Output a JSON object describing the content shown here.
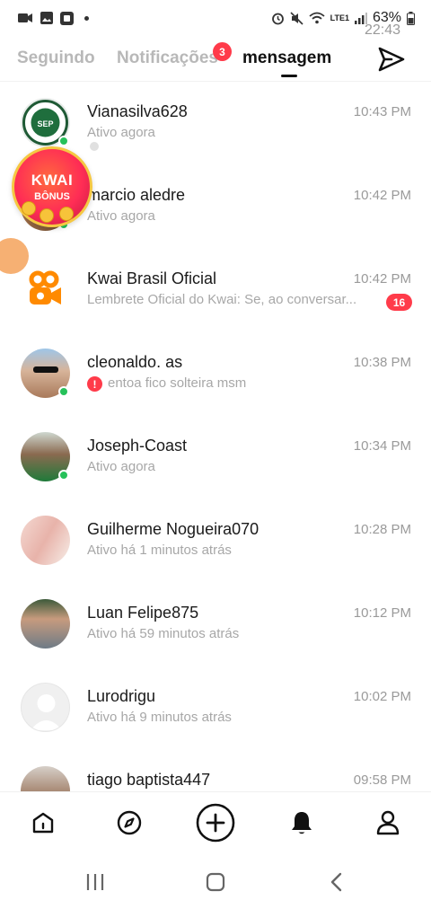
{
  "status_bar": {
    "time": "22:43",
    "battery": "63%",
    "network": "LTE1"
  },
  "tabs": [
    {
      "label": "Seguindo",
      "active": false
    },
    {
      "label": "Notificações",
      "active": false,
      "badge": "3"
    },
    {
      "label": "mensagem",
      "active": true
    }
  ],
  "conversations": [
    {
      "name": "Vianasilva628",
      "time": "10:43 PM",
      "subtitle": "Ativo agora",
      "online": true,
      "avatar": "palmeiras-logo"
    },
    {
      "name": "marcio aledre",
      "time": "10:42 PM",
      "subtitle": "Ativo agora",
      "online": true,
      "avatar": "photo"
    },
    {
      "name": "Kwai Brasil Oficial",
      "time": "10:42 PM",
      "subtitle": "Lembrete Oficial do Kwai: Se, ao conversar...",
      "unread": "16",
      "avatar": "kwai-logo"
    },
    {
      "name": "cleonaldo. as",
      "time": "10:38 PM",
      "subtitle": "entoa fico solteira msm",
      "alert": "!",
      "online": true,
      "avatar": "photo"
    },
    {
      "name": "Joseph-Coast",
      "time": "10:34 PM",
      "subtitle": "Ativo agora",
      "online": true,
      "avatar": "photo"
    },
    {
      "name": "Guilherme Nogueira070",
      "time": "10:28 PM",
      "subtitle": "Ativo há 1 minutos atrás",
      "avatar": "photo"
    },
    {
      "name": "Luan Felipe875",
      "time": "10:12 PM",
      "subtitle": "Ativo há 59 minutos atrás",
      "avatar": "photo"
    },
    {
      "name": "Lurodrigu",
      "time": "10:02 PM",
      "subtitle": "Ativo há 9 minutos atrás",
      "avatar": "default-avatar"
    },
    {
      "name": "tiago baptista447",
      "time": "09:58 PM",
      "subtitle": "",
      "avatar": "photo"
    }
  ],
  "kwai_bonus": {
    "line1": "KWAI",
    "line2": "BÔNUS"
  },
  "bottom_nav": [
    {
      "icon": "home-icon"
    },
    {
      "icon": "compass-icon"
    },
    {
      "icon": "create-icon"
    },
    {
      "icon": "bell-icon"
    },
    {
      "icon": "profile-icon"
    }
  ],
  "colors": {
    "accent": "#ff3b4a",
    "online": "#26c15a",
    "muted": "#a7a7a7"
  }
}
